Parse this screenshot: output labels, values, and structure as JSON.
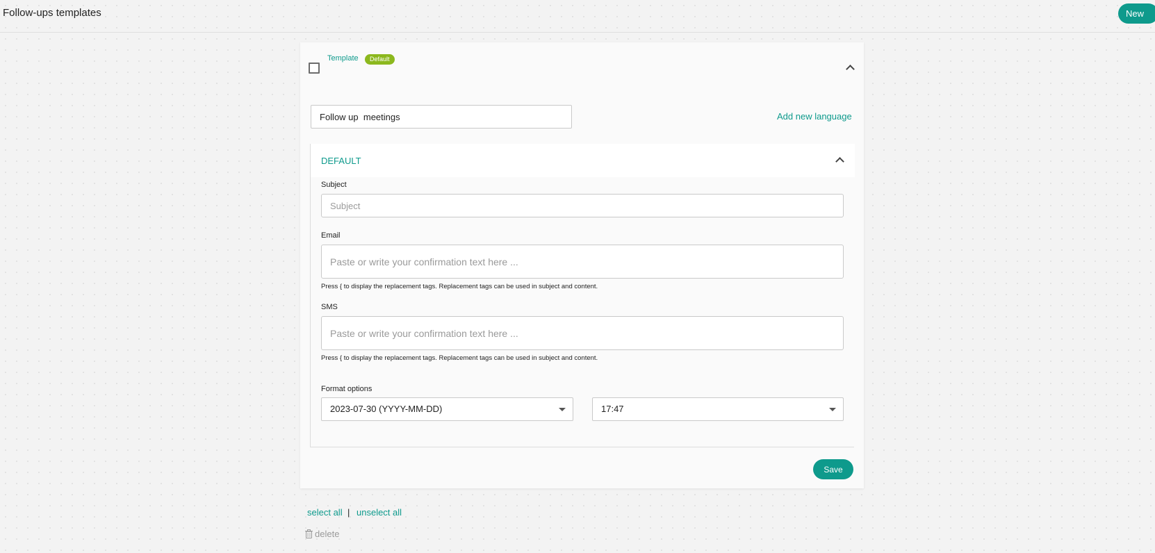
{
  "header": {
    "title": "Follow-ups templates",
    "new_label": "New"
  },
  "colors": {
    "accent": "#0e9a8c",
    "badge": "#8cb81e"
  },
  "template": {
    "label": "Template",
    "badge": "Default",
    "name_value": "Follow up  meetings",
    "add_language_label": "Add new language",
    "language_panel": {
      "title": "DEFAULT",
      "subject_label": "Subject",
      "subject_placeholder": "Subject",
      "email_label": "Email",
      "email_placeholder": "Paste or write your confirmation text here ...",
      "email_hint": "Press { to display the replacement tags. Replacement tags can be used in subject and content.",
      "sms_label": "SMS",
      "sms_placeholder": "Paste or write your confirmation text here ...",
      "sms_hint": "Press { to display the replacement tags. Replacement tags can be used in subject and content.",
      "format_label": "Format options",
      "date_format_value": "2023-07-30 (YYYY-MM-DD)",
      "time_format_value": "17:47"
    },
    "save_label": "Save"
  },
  "footer": {
    "select_all": "select all",
    "separator": "|",
    "unselect_all": "unselect all",
    "delete_label": "delete"
  }
}
